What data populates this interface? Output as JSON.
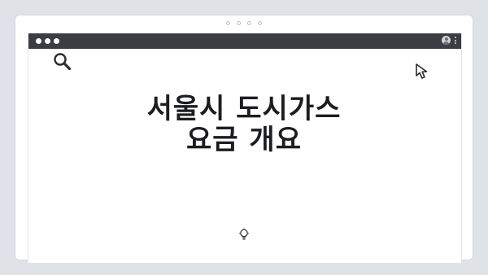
{
  "pager": {
    "count": 4,
    "active": 0
  },
  "browser": {
    "traffic_lights": [
      "dot",
      "dot",
      "dot"
    ],
    "right_icons": [
      "account-icon",
      "kebab-menu-icon"
    ]
  },
  "main": {
    "title_line1": "서울시 도시가스",
    "title_line2": "요금 개요"
  },
  "icons": {
    "search": "search-icon",
    "cursor": "cursor-icon",
    "bottom": "lightbulb-icon"
  },
  "colors": {
    "background": "#dfe3e8",
    "titlebar": "#3a3d42",
    "text": "#1c1d20"
  }
}
